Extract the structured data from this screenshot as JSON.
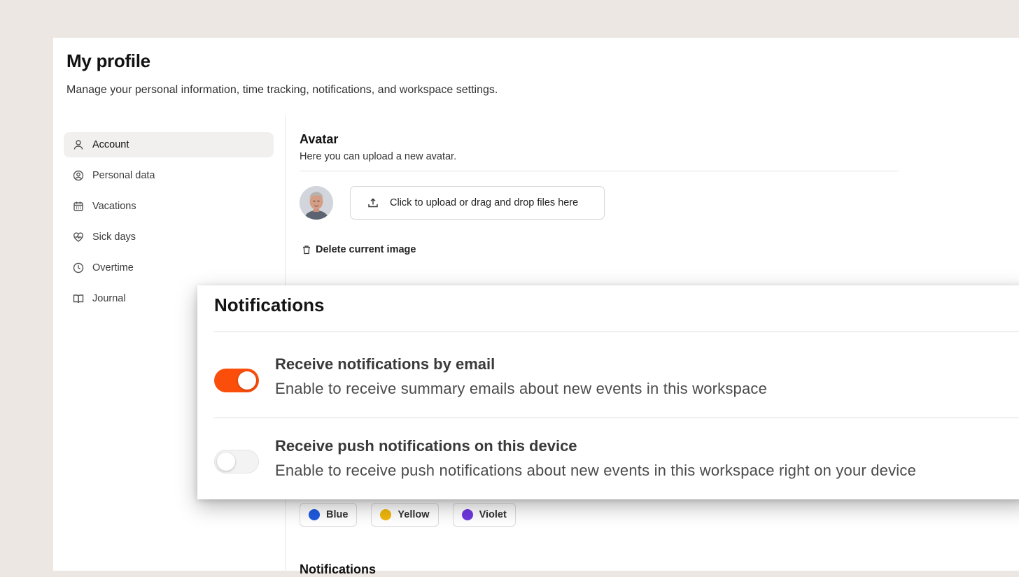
{
  "page": {
    "title": "My profile",
    "subtitle": "Manage your personal information, time tracking, notifications, and workspace settings."
  },
  "sidebar": {
    "items": [
      {
        "label": "Account",
        "icon": "user-icon",
        "active": true
      },
      {
        "label": "Personal data",
        "icon": "user-circle-icon",
        "active": false
      },
      {
        "label": "Vacations",
        "icon": "calendar-icon",
        "active": false
      },
      {
        "label": "Sick days",
        "icon": "heart-pulse-icon",
        "active": false
      },
      {
        "label": "Overtime",
        "icon": "clock-icon",
        "active": false
      },
      {
        "label": "Journal",
        "icon": "book-icon",
        "active": false
      }
    ]
  },
  "avatar_section": {
    "title": "Avatar",
    "description": "Here you can upload a new avatar.",
    "upload_label": "Click to upload or drag and drop files here",
    "delete_label": "Delete current image"
  },
  "color_options": [
    {
      "label": "Blue",
      "color": "#1f5ae0"
    },
    {
      "label": "Yellow",
      "color": "#f2b70c"
    },
    {
      "label": "Violet",
      "color": "#6f37e0"
    }
  ],
  "notifications_section": {
    "title": "Notifications"
  },
  "notifications_overlay": {
    "title": "Notifications",
    "accent_color": "#fb4e0b",
    "rows": [
      {
        "title": "Receive notifications by email",
        "description": "Enable to receive summary emails about new events in this workspace",
        "enabled": true
      },
      {
        "title": "Receive push notifications on this device",
        "description": "Enable to receive push notifications about new events in this workspace right on your device",
        "enabled": false
      }
    ]
  }
}
